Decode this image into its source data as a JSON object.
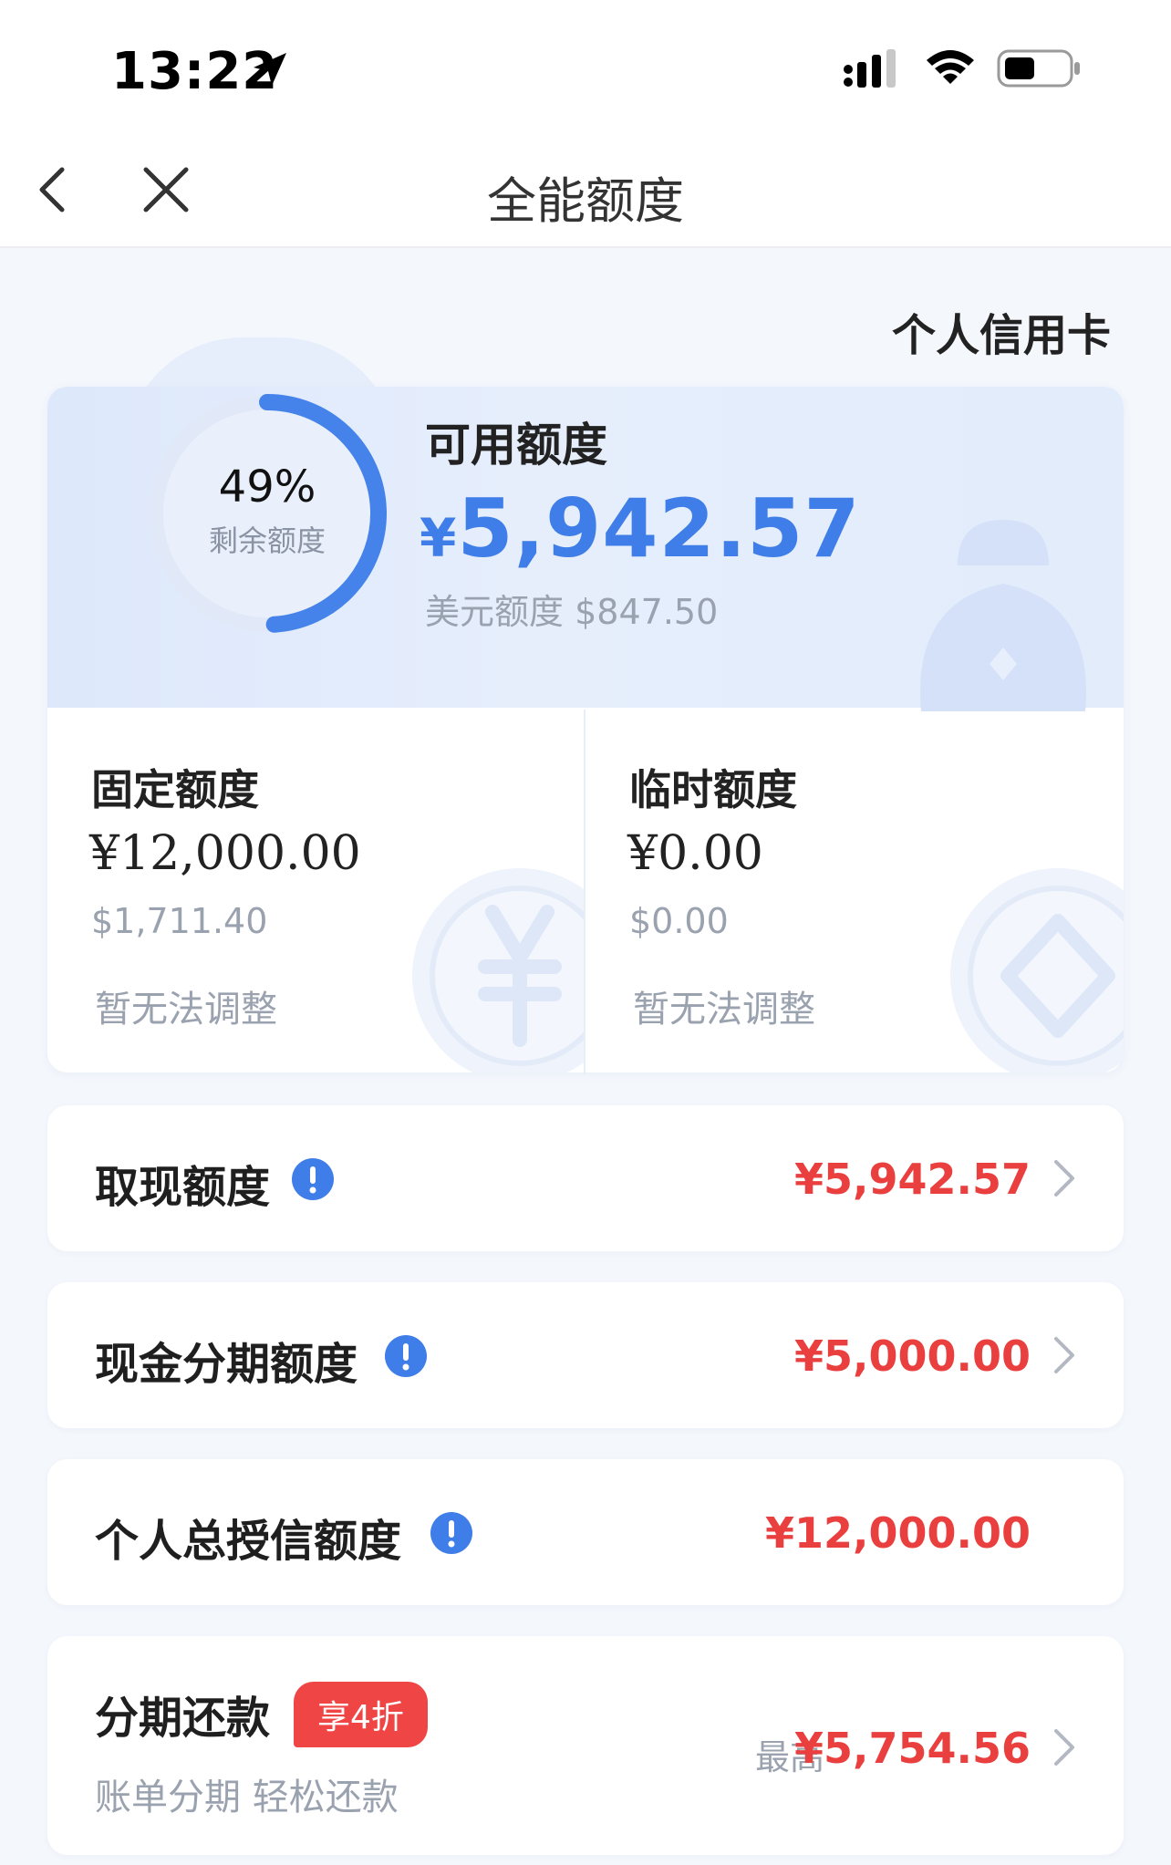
{
  "status_bar": {
    "time": "13:22"
  },
  "nav": {
    "title": "全能额度"
  },
  "card_link": "个人信用卡",
  "summary": {
    "gauge_percent": "49%",
    "gauge_fraction": 0.49,
    "gauge_label": "剩余额度",
    "available_title": "可用额度",
    "available_currency": "¥",
    "available_amount": "5,942.57",
    "usd_label": "美元额度",
    "usd_amount": "$847.50"
  },
  "fixed": {
    "title": "固定额度",
    "amount": "¥12,000.00",
    "usd": "$1,711.40",
    "note": "暂无法调整"
  },
  "temp": {
    "title": "临时额度",
    "amount": "¥0.00",
    "usd": "$0.00",
    "note": "暂无法调整"
  },
  "rows": [
    {
      "label": "取现额度",
      "value": "¥5,942.57"
    },
    {
      "label": "现金分期额度",
      "value": "¥5,000.00"
    },
    {
      "label": "个人总授信额度",
      "value": "¥12,000.00"
    }
  ],
  "installment": {
    "label": "分期还款",
    "badge": "享4折",
    "subtitle": "账单分期 轻松还款",
    "max_label": "最高",
    "value": "¥5,754.56"
  },
  "colors": {
    "accent_blue": "#3f7ee8",
    "value_red": "#ea3f3f",
    "badge_red": "#f04545"
  }
}
